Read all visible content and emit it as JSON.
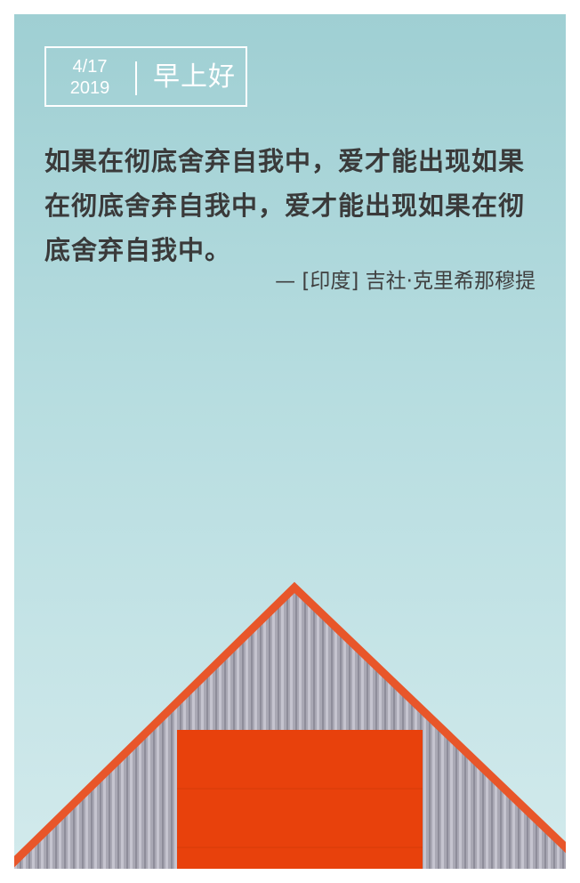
{
  "card": {
    "date_line1": "4/17",
    "date_line2": "2019",
    "greeting": "早上好",
    "quote": "如果在彻底舍弃自我中，爱才能出现如果在彻底舍弃自我中，爱才能出现如果在彻底舍弃自我中。",
    "attribution": "— [印度] 吉社·克里希那穆提"
  },
  "colors": {
    "sky_top": "#9fcfd3",
    "sky_bottom": "#d2eaec",
    "roof_edge": "#e8562a",
    "roof_panel": "#e8410c",
    "siding": "#a9a8b4",
    "text": "#3a3a3a"
  }
}
